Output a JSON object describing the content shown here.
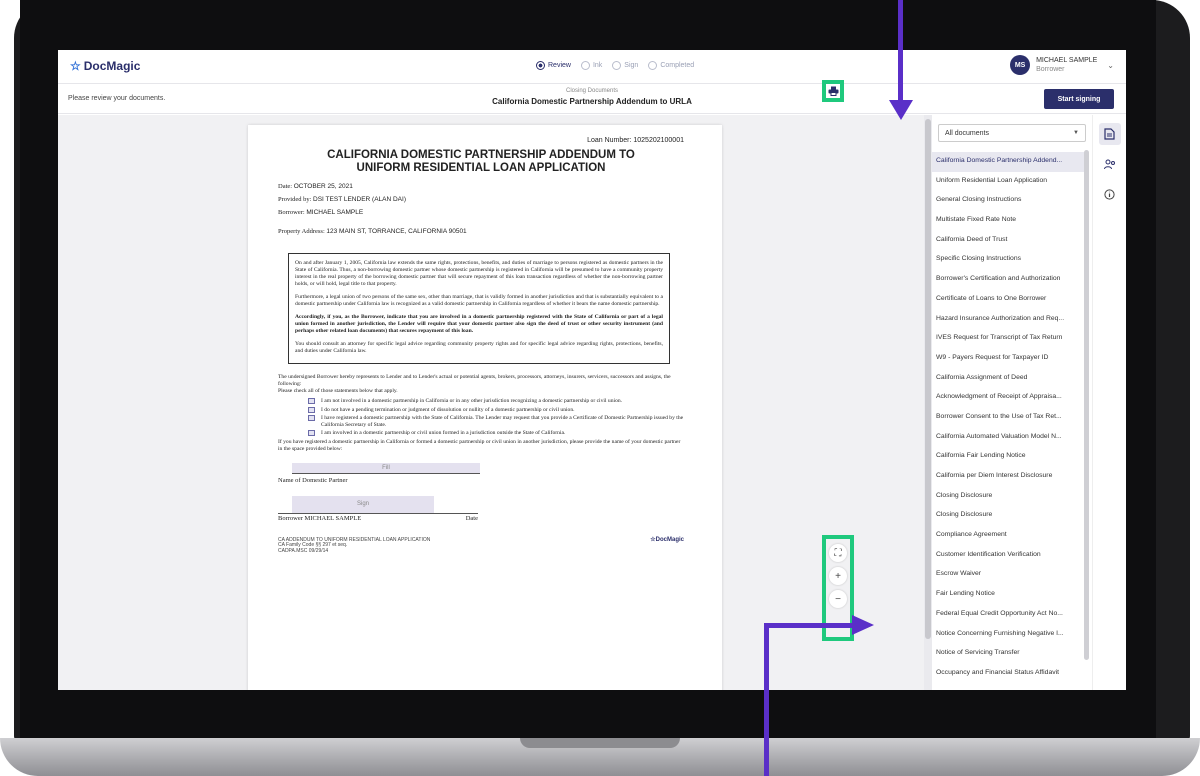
{
  "app": {
    "logo": "DocMagic"
  },
  "steps": [
    {
      "label": "Review",
      "active": true
    },
    {
      "label": "Ink",
      "active": false
    },
    {
      "label": "Sign",
      "active": false
    },
    {
      "label": "Completed",
      "active": false
    }
  ],
  "user": {
    "initials": "MS",
    "name": "MICHAEL SAMPLE",
    "role": "Borrower"
  },
  "subbar": {
    "instruction": "Please review your documents.",
    "section": "Closing Documents",
    "title": "California Domestic Partnership Addendum to URLA",
    "start_button": "Start signing"
  },
  "document": {
    "loan_number": "Loan Number: 1025202100001",
    "title_line1": "CALIFORNIA DOMESTIC PARTNERSHIP ADDENDUM TO",
    "title_line2": "UNIFORM RESIDENTIAL LOAN APPLICATION",
    "date_label": "Date:",
    "date": "OCTOBER 25, 2021",
    "provided_label": "Provided by:",
    "provided": "DSI TEST LENDER (ALAN DAI)",
    "borrower_label": "Borrower:",
    "borrower": "MICHAEL SAMPLE",
    "property_label": "Property Address:",
    "property": "123 MAIN ST, TORRANCE, CALIFORNIA 90501",
    "box_p1": "On and after January 1, 2005, California law extends the same rights, protections, benefits, and duties of marriage to persons registered as domestic partners in the State of California. Thus, a non-borrowing domestic partner whose domestic partnership is registered in California will be presumed to have a community property interest in the real property of the borrowing domestic partner that will secure repayment of this loan transaction regardless of whether the non-borrowing partner holds, or will hold, legal title to that property.",
    "box_p2": "Furthermore, a legal union of two persons of the same sex, other than marriage, that is validly formed in another jurisdiction and that is substantially equivalent to a domestic partnership under California law is recognized as a valid domestic partnership in California regardless of whether it bears the name domestic partnership.",
    "box_p3": "Accordingly, if you, as the Borrower, indicate that you are involved in a domestic partnership registered with the State of California or part of a legal union formed in another jurisdiction, the Lender will require that your domestic partner also sign the deed of trust or other security instrument (and perhaps other related loan documents) that secures repayment of this loan.",
    "box_p4": "You should consult an attorney for specific legal advice regarding community property rights and for specific legal advice regarding rights, protections, benefits, and duties under California law.",
    "undersigned": "The undersigned Borrower hereby represents to Lender and to Lender's actual or potential agents, brokers, processors, attorneys, insurers, servicers, successors and assigns, the following:",
    "check_all": "Please check all of those statements below that apply.",
    "check1": "I am not involved in a domestic partnership in California or in any other jurisdiction recognizing a domestic partnership or civil union.",
    "check2": "I do not have a pending termination or judgment of dissolution or nullity of a domestic partnership or civil union.",
    "check3": "I have registered a domestic partnership with the State of California. The Lender may request that you provide a Certificate of Domestic Partnership issued by the California Secretary of State.",
    "check4": "I am involved in a domestic partnership or civil union formed in a jurisdiction outside the State of California.",
    "if_registered": "If you have registered a domestic partnership in California or formed a domestic partnership or civil union in another jurisdiction, please provide the name of your domestic partner in the space provided below:",
    "fill_label": "Fill",
    "partner_label": "Name of Domestic Partner",
    "sign_label": "Sign",
    "sig_borrower": "Borrower  MICHAEL SAMPLE",
    "sig_date": "Date",
    "footer_l1": "CA ADDENDUM TO UNIFORM RESIDENTIAL LOAN APPLICATION",
    "footer_l2": "CA Family Code §§ 297 et seq.",
    "footer_l3": "CADPA.MSC  09/29/14",
    "footer_logo": "DocMagic"
  },
  "panel": {
    "filter": "All documents",
    "docs": [
      "California Domestic Partnership Addend...",
      "Uniform Residential Loan Application",
      "General Closing Instructions",
      "Multistate Fixed Rate Note",
      "California Deed of Trust",
      "Specific Closing Instructions",
      "Borrower's Certification and Authorization",
      "Certificate of Loans to One Borrower",
      "Hazard Insurance Authorization and Req...",
      "IVES Request for Transcript of Tax Return",
      "W9 - Payers Request for Taxpayer ID",
      "California Assignment of Deed",
      "Acknowledgment of Receipt of Appraisa...",
      "Borrower Consent to the Use of Tax Ret...",
      "California Automated Valuation Model N...",
      "California Fair Lending Notice",
      "California per Diem Interest Disclosure",
      "Closing Disclosure",
      "Closing Disclosure",
      "Compliance Agreement",
      "Customer Identification Verification",
      "Escrow Waiver",
      "Fair Lending Notice",
      "Federal Equal Credit Opportunity Act No...",
      "Notice Concerning Furnishing Negative I...",
      "Notice of Servicing Transfer",
      "Occupancy and Financial Status Affidavit"
    ]
  },
  "colors": {
    "brand": "#2b2f6b",
    "highlight": "#1fc97d",
    "arrow": "#5a2fc8"
  }
}
